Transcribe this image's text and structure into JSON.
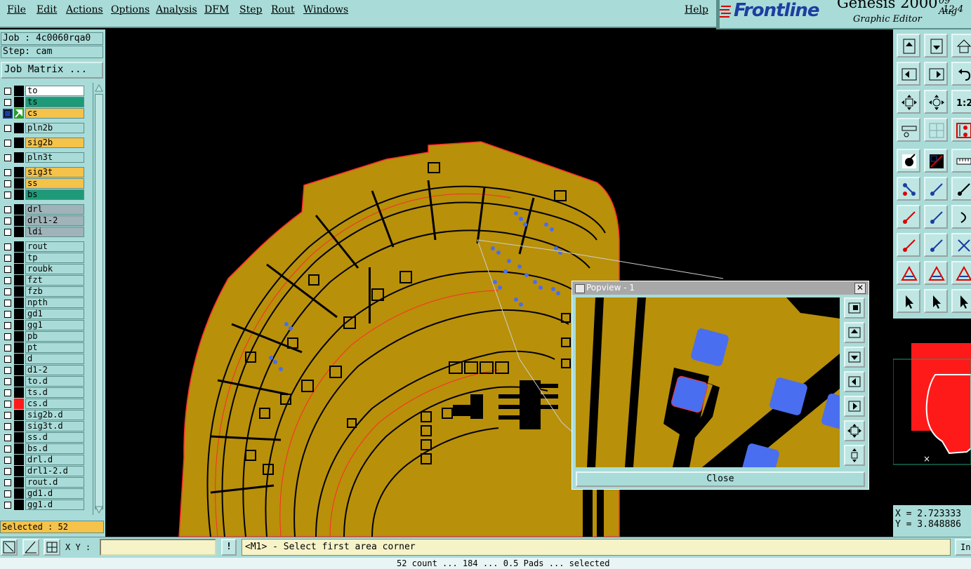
{
  "menu": {
    "items": [
      "File",
      "Edit",
      "Actions",
      "Options",
      "Analysis",
      "DFM",
      "Step",
      "Rout",
      "Windows"
    ],
    "help": "Help"
  },
  "brand": {
    "logo": "Frontline",
    "product": "Genesis 2000",
    "subtitle": "Graphic Editor",
    "date": "09 Aug",
    "time": "12:4"
  },
  "job": {
    "job_line": "Job : 4c0060rqa0",
    "step_line": "Step: cam",
    "matrix_button": "Job Matrix ..."
  },
  "layers": [
    {
      "name": "to",
      "color": "#ffffff"
    },
    {
      "name": "ts",
      "color": "#1f9a78"
    },
    {
      "name": "cs",
      "color": "#f5c24a",
      "selected": true
    },
    {
      "name": "pln2b",
      "color": "#a9dcd8"
    },
    {
      "name": "sig2b",
      "color": "#f5c24a"
    },
    {
      "name": "pln3t",
      "color": "#a9dcd8"
    },
    {
      "name": "sig3t",
      "color": "#f5c24a"
    },
    {
      "name": "ss",
      "color": "#f5c24a"
    },
    {
      "name": "bs",
      "color": "#1f9a78"
    },
    {
      "name": "drl",
      "color": "#9fb3b8"
    },
    {
      "name": "drl1-2",
      "color": "#9fb3b8"
    },
    {
      "name": "ldi",
      "color": "#9fb3b8"
    },
    {
      "name": "rout",
      "color": "#a9dcd8"
    },
    {
      "name": "tp",
      "color": "#a9dcd8"
    },
    {
      "name": "roubk",
      "color": "#a9dcd8"
    },
    {
      "name": "fzt",
      "color": "#a9dcd8"
    },
    {
      "name": "fzb",
      "color": "#a9dcd8"
    },
    {
      "name": "npth",
      "color": "#a9dcd8"
    },
    {
      "name": "gd1",
      "color": "#a9dcd8"
    },
    {
      "name": "gg1",
      "color": "#a9dcd8"
    },
    {
      "name": "pb",
      "color": "#a9dcd8"
    },
    {
      "name": "pt",
      "color": "#a9dcd8"
    },
    {
      "name": "d",
      "color": "#a9dcd8"
    },
    {
      "name": "d1-2",
      "color": "#a9dcd8"
    },
    {
      "name": "to.d",
      "color": "#a9dcd8"
    },
    {
      "name": "ts.d",
      "color": "#a9dcd8"
    },
    {
      "name": "cs.d",
      "color": "#a9dcd8",
      "marked": true
    },
    {
      "name": "sig2b.d",
      "color": "#a9dcd8"
    },
    {
      "name": "sig3t.d",
      "color": "#a9dcd8"
    },
    {
      "name": "ss.d",
      "color": "#a9dcd8"
    },
    {
      "name": "bs.d",
      "color": "#a9dcd8"
    },
    {
      "name": "drl.d",
      "color": "#a9dcd8"
    },
    {
      "name": "drl1-2.d",
      "color": "#a9dcd8"
    },
    {
      "name": "rout.d",
      "color": "#a9dcd8"
    },
    {
      "name": "gd1.d",
      "color": "#a9dcd8"
    },
    {
      "name": "gg1.d",
      "color": "#a9dcd8"
    }
  ],
  "status": {
    "selected": "Selected : 52",
    "xy_label": "X Y :",
    "xy_value": "",
    "message": "<M1> - Select first area corner",
    "footer": "52 count ... 184 ... 0.5 Pads ... selected",
    "right_btn": "In"
  },
  "coords": {
    "x": "X = 2.723333",
    "y": "Y = 3.848886"
  },
  "popview": {
    "title": "Popview - 1",
    "close_label": "Close",
    "close_x": "✕"
  },
  "colors": {
    "panel": "#a9dcd8",
    "copper": "#b8900a",
    "pad_blue": "#4a6ef0",
    "outline_red": "#ff2a2a",
    "highlight_yellow": "#f5c24a"
  },
  "icons": {
    "right_toolbar": [
      "page-up-icon",
      "page-down-icon",
      "home-icon",
      "page-left-icon",
      "page-right-icon",
      "undo-view-icon",
      "fit-all-icon",
      "fit-profile-icon",
      "zoom-one-to-two-icon",
      "measure-icon",
      "grid-icon",
      "snap-icon",
      "select-pad-icon",
      "select-line-icon",
      "ruler-icon",
      "connect-icon",
      "delete-icon",
      "move-icon",
      "draw-line-icon",
      "draw-line-alt-icon",
      "arc-icon",
      "pad-add-icon",
      "line-cut-icon",
      "cross-icon",
      "triangle-icon",
      "triangle-arrow-icon",
      "triangle-alt-icon",
      "cursor-icon",
      "cursor-box-icon",
      "cursor-circle-icon"
    ]
  }
}
